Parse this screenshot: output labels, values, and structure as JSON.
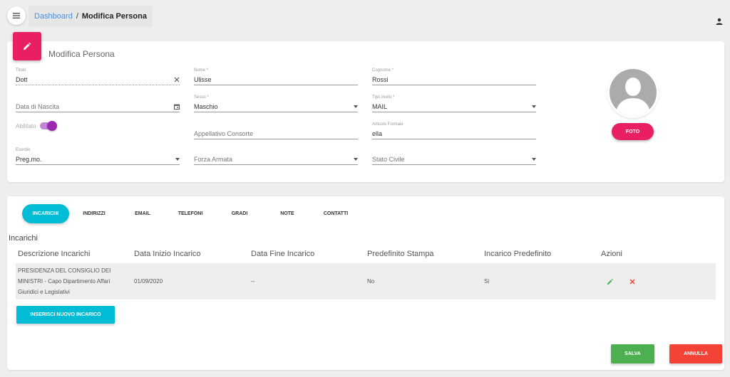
{
  "breadcrumb": {
    "home": "Dashboard",
    "separator": "/",
    "current": "Modifica Persona"
  },
  "card_title": "Modifica Persona",
  "fields": {
    "titolo": {
      "label": "Titolo",
      "value": "Dott"
    },
    "nome": {
      "label": "Nome *",
      "value": "Ulisse"
    },
    "cognome": {
      "label": "Cognome *",
      "value": "Rossi"
    },
    "data_nascita": {
      "placeholder": "Data di Nascita"
    },
    "sesso": {
      "label": "Sesso *",
      "value": "Maschio"
    },
    "tipo_invito": {
      "label": "Tipo Invito *",
      "value": "MAIL"
    },
    "abilitato": {
      "label": "Abilitato",
      "on": true
    },
    "appellativo": {
      "placeholder": "Appellativo Consorte"
    },
    "articolo": {
      "label": "Articolo Formale",
      "value": "ella"
    },
    "esordio": {
      "label": "Esordio",
      "value": "Preg.mo."
    },
    "forza_armata": {
      "placeholder": "Forza Armata"
    },
    "stato_civile": {
      "placeholder": "Stato Civile"
    }
  },
  "foto_button": "FOTO",
  "tabs": [
    "INCARICHI",
    "INDIRIZZI",
    "EMAIL",
    "TELEFONI",
    "GRADI",
    "NOTE",
    "CONTATTI"
  ],
  "section_title": "Incarichi",
  "table": {
    "headers": [
      "Descrizione Incarichi",
      "Data Inizio Incarico",
      "Data Fine Incarico",
      "Predefinito Stampa",
      "Incarico Predefinito",
      "Azioni"
    ],
    "rows": [
      {
        "descrizione": [
          "PRESIDENZA DEL CONSIGLIO DEI",
          "MINISTRI - Capo Dipartimento Affari",
          "Giuridici e Legislativi"
        ],
        "data_inizio": "01/09/2020",
        "data_fine": "--",
        "predefinito_stampa": "No",
        "incarico_predefinito": "Si"
      }
    ]
  },
  "add_button": "INSERISCI NUOVO INCARICO",
  "save_button": "SALVA",
  "cancel_button": "ANNULLA",
  "colors": {
    "pink": "#e91e63",
    "cyan": "#00bcd4",
    "green": "#4caf50",
    "red": "#f44336",
    "purple": "#9c27b0"
  }
}
